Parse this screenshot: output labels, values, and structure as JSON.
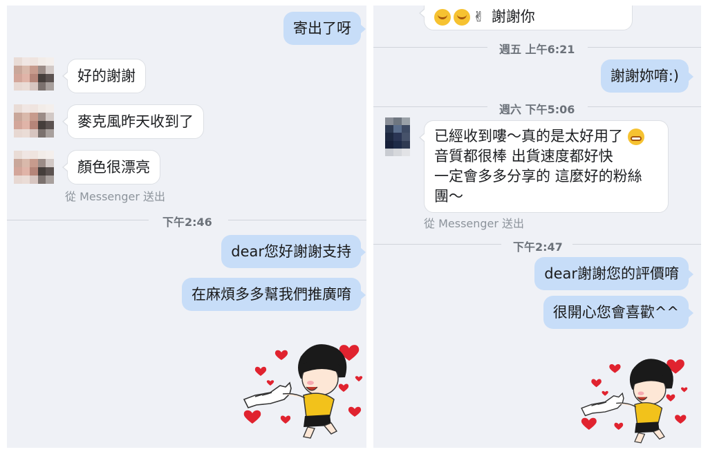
{
  "left": {
    "messages_out_top": "寄出了呀",
    "incoming": [
      "好的謝謝",
      "麥克風昨天收到了",
      "顏色很漂亮"
    ],
    "via": "從 Messenger 送出",
    "time": "下午2:46",
    "messages_out": [
      "dear您好謝謝支持",
      "在麻煩多多幫我們推廣唷"
    ]
  },
  "right": {
    "top_bubble_text": "謝謝你",
    "time1": "週五 上午6:21",
    "out1": "謝謝妳唷:)",
    "time2": "週六 下午5:06",
    "incoming_lines": [
      "已經收到嘍～真的是太好用了",
      "音質都很棒 出貨速度都好快",
      "一定會多多分享的 這麼好的粉絲",
      "團～"
    ],
    "via": "從 Messenger 送出",
    "time3": "下午2:47",
    "messages_out": [
      "dear謝謝您的評價唷",
      "很開心您會喜歡^^"
    ]
  },
  "colors": {
    "outgoing_bubble": "#c7ddf8",
    "incoming_bubble": "#ffffff",
    "panel_bg": "#eff1f6",
    "heart": "#e0232f",
    "shirt": "#f2c21b"
  },
  "icons": [
    "smile-emoji-icon",
    "victory-hand-icon",
    "grin-emoji-icon",
    "heart-icon"
  ]
}
